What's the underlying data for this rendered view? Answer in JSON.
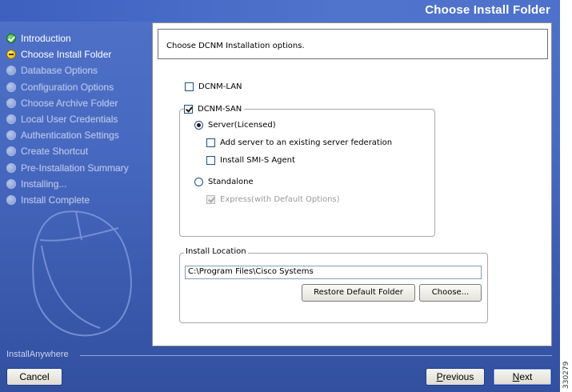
{
  "window": {
    "title": "Choose Install Folder",
    "brand": "InstallAnywhere"
  },
  "steps": [
    {
      "label": "Introduction",
      "state": "done"
    },
    {
      "label": "Choose Install Folder",
      "state": "current"
    },
    {
      "label": "Database Options",
      "state": "pending"
    },
    {
      "label": "Configuration Options",
      "state": "pending"
    },
    {
      "label": "Choose Archive Folder",
      "state": "pending"
    },
    {
      "label": "Local User Credentials",
      "state": "pending"
    },
    {
      "label": "Authentication Settings",
      "state": "pending"
    },
    {
      "label": "Create Shortcut",
      "state": "pending"
    },
    {
      "label": "Pre-Installation Summary",
      "state": "pending"
    },
    {
      "label": "Installing...",
      "state": "pending"
    },
    {
      "label": "Install Complete",
      "state": "pending"
    }
  ],
  "main": {
    "instructions": "Choose DCNM Installation options.",
    "dcnm_lan": {
      "label": "DCNM-LAN",
      "checked": false
    },
    "dcnm_san": {
      "label": "DCNM-SAN",
      "checked": true
    },
    "server": {
      "label": "Server(Licensed)",
      "selected": true
    },
    "add_server": {
      "label": "Add server to an existing server federation",
      "checked": false
    },
    "smis": {
      "label": "Install SMI-S Agent",
      "checked": false
    },
    "standalone": {
      "label": "Standalone",
      "selected": false
    },
    "express": {
      "label": "Express(with Default Options)",
      "checked": true,
      "disabled": true
    },
    "install_location": {
      "legend": "Install Location",
      "path": "C:\\Program Files\\Cisco Systems",
      "restore_label": "Restore Default Folder",
      "choose_label": "Choose..."
    }
  },
  "footer": {
    "cancel": "Cancel",
    "previous_prefix": "P",
    "previous_rest": "revious",
    "next_prefix": "N",
    "next_rest": "ext"
  },
  "side_number": "330279",
  "colors": {
    "accent": "#4668bf",
    "title_text": "#ffffff"
  }
}
